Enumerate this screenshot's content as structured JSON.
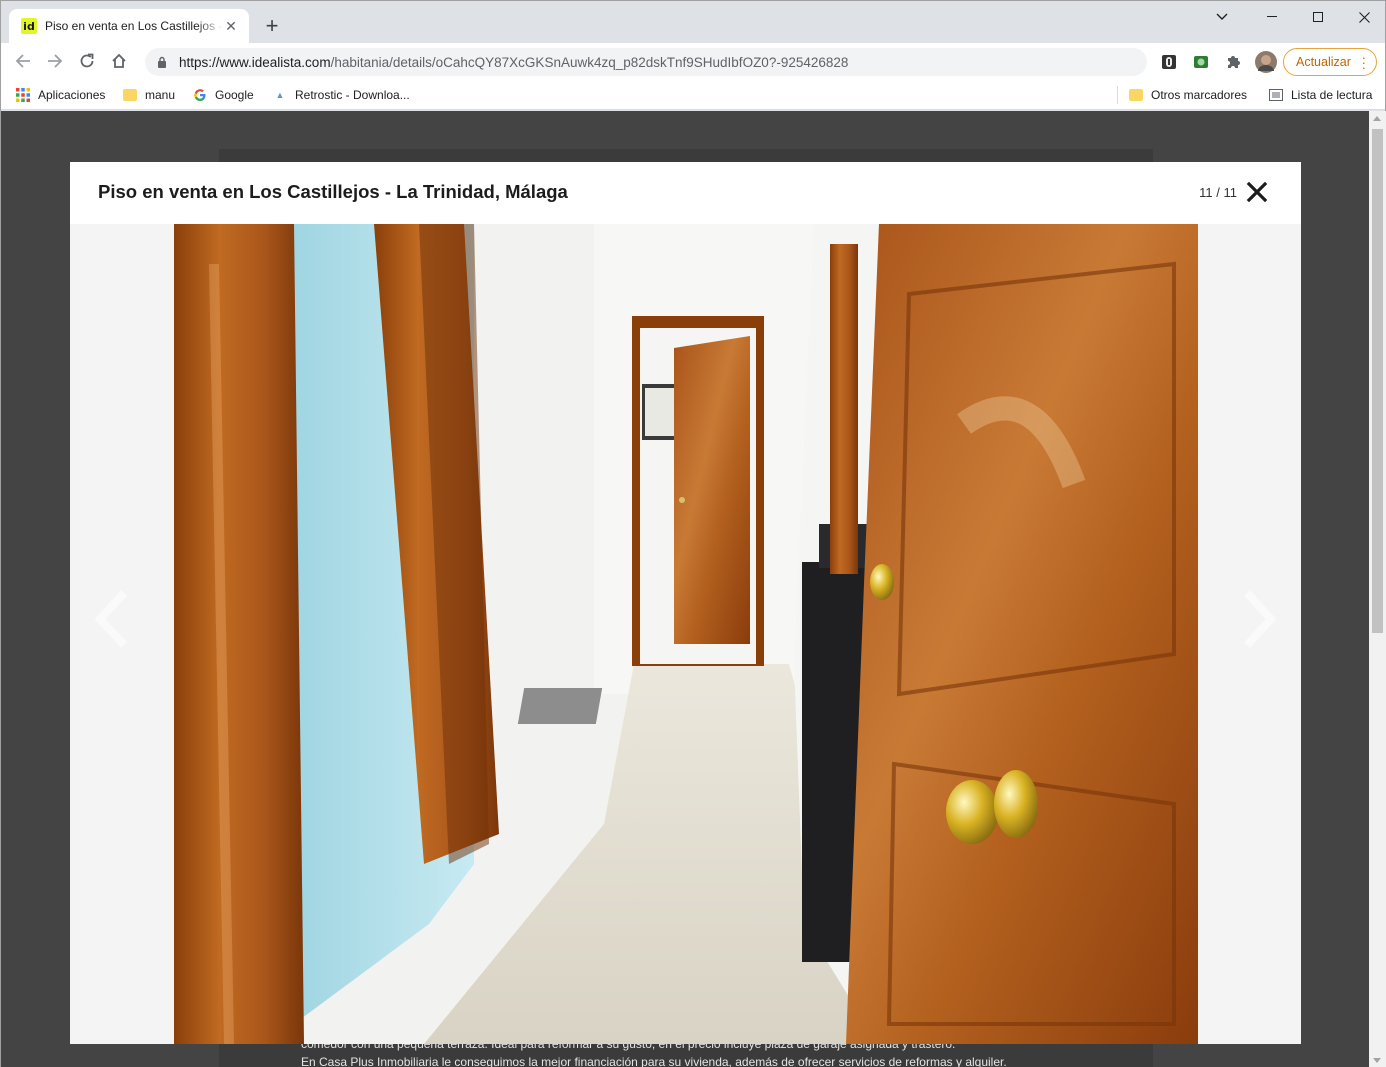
{
  "browser": {
    "tab_title": "Piso en venta en Los Castillejos - La Trinidad, Málaga",
    "favicon_text": "id",
    "tab_close": "✕",
    "new_tab": "+",
    "window_controls": {
      "minimize": "—",
      "restore": "☐",
      "close": "✕"
    },
    "url_host": "https://www.idealista.com",
    "url_path": "/habitania/details/oCahcQY87XcGKSnAuwk4zq_p82dskTnf9SHudIbfOZ0?-925426828",
    "update_button": "Actualizar",
    "bookmarks": [
      {
        "label": "Aplicaciones",
        "icon": "apps-grid-icon"
      },
      {
        "label": "manu",
        "icon": "folder-icon"
      },
      {
        "label": "Google",
        "icon": "google-icon"
      },
      {
        "label": "Retrostic - Downloa...",
        "icon": "retrostic-icon"
      }
    ],
    "other_bookmarks": "Otros marcadores",
    "reading_list": "Lista de lectura"
  },
  "page": {
    "background_text": [
      "comedor con una pequeña terraza. Ideal para reformar a su gusto, en el precio incluye plaza de garaje asignada y trastero.",
      "En Casa Plus Inmobiliaria le conseguimos la mejor financiación para su vivienda, además de ofrecer servicios de reformas y alquiler."
    ]
  },
  "gallery": {
    "title": "Piso en venta en Los Castillejos - La Trinidad, Málaga",
    "counter": "11 / 11",
    "photo_alt": "Pasillo con puertas de madera y paredes azules"
  },
  "colors": {
    "accent_update": "#c26401",
    "favicon_bg": "#e1f527",
    "overlay": "#444444"
  }
}
